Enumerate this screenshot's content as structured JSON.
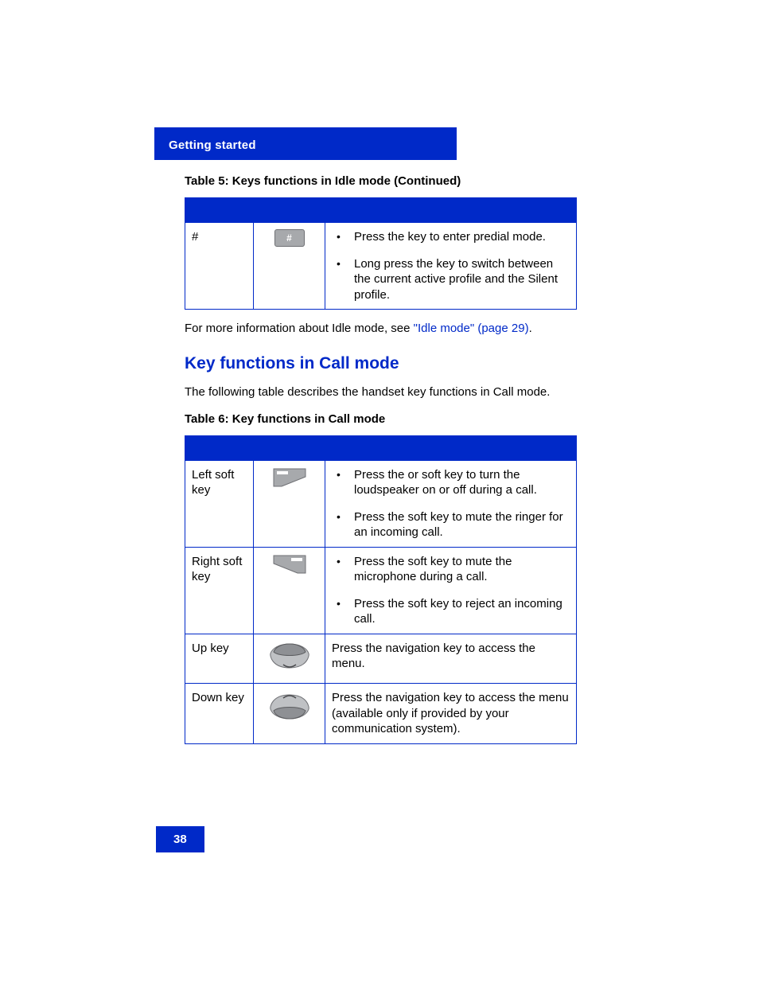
{
  "header": {
    "section": "Getting started"
  },
  "table5": {
    "caption": "Table 5: Keys functions in Idle mode  (Continued)",
    "row": {
      "name": "#",
      "key_glyph": "#",
      "bullets": [
        "Press the    key to enter predial mode.",
        "Long press the    key to switch between the current active profile and the Silent profile."
      ]
    }
  },
  "para_more_info_a": "For more information about Idle mode, see ",
  "para_more_info_link": "\"Idle mode\" (page 29)",
  "para_more_info_b": ".",
  "h2": "Key functions in Call mode",
  "para_intro": "The following table describes the handset key functions in Call mode.",
  "table6": {
    "caption": "Table 6: Key functions in Call mode",
    "rows": [
      {
        "name": "Left soft key",
        "icon": "left-soft",
        "bullets": [
          "Press the             or              soft key to turn the loudspeaker on or off during a call.",
          "Press the              soft key to mute the ringer for an incoming call."
        ]
      },
      {
        "name": "Right soft key",
        "icon": "right-soft",
        "bullets": [
          "Press the           soft key to mute the microphone during a call.",
          "Press the              soft key to reject an incoming call."
        ]
      },
      {
        "name": "Up key",
        "icon": "up",
        "plain": "Press the         navigation key to access the               menu."
      },
      {
        "name": "Down key",
        "icon": "down",
        "plain": "Press the            navigation key to access the                           menu (available only if provided by your communication system)."
      }
    ]
  },
  "page_number": "38"
}
